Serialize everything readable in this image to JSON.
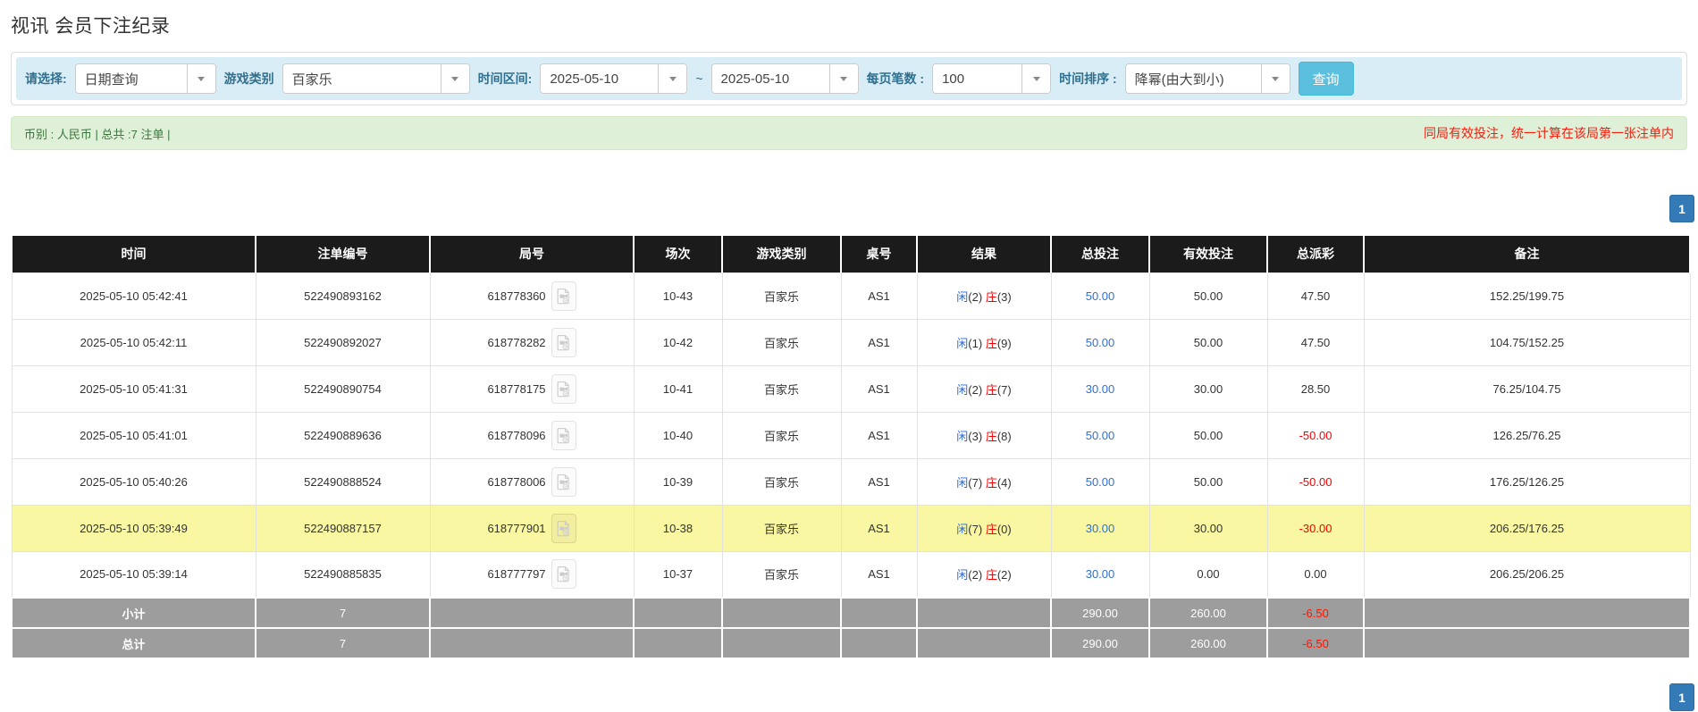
{
  "page": {
    "title": "视讯 会员下注纪录"
  },
  "colors": {
    "accent_blue": "#2e6fd8",
    "banker_red": "#f20000",
    "highlight_yellow": "#f9f7a1",
    "header_black": "#1b1b1b",
    "summary_gray": "#9d9d9d",
    "search_button_blue": "#5bc0de",
    "pagination_blue": "#337ab7",
    "filter_bar_blue": "#d9edf7",
    "info_bar_green": "#dff0d8"
  },
  "filter_bar": {
    "query_type": {
      "label": "请选择:",
      "value": "日期查询"
    },
    "game_category": {
      "label": "游戏类别",
      "value": "百家乐"
    },
    "time_range": {
      "label": "时间区间:",
      "from": "2025-05-10",
      "separator": "~",
      "to": "2025-05-10"
    },
    "page_size": {
      "label": "每页笔数 :",
      "value": "100"
    },
    "time_sort": {
      "label": "时间排序 :",
      "value": "降幂(由大到小)"
    },
    "search_button": "查询"
  },
  "info_bar": {
    "summary": "币别 : 人民币 | 总共 :7 注单 |",
    "notice": "同局有效投注，统一计算在该局第一张注单内"
  },
  "pagination": {
    "page": "1"
  },
  "table": {
    "columns": [
      "时间",
      "注单编号",
      "局号",
      "场次",
      "游戏类别",
      "桌号",
      "结果",
      "总投注",
      "有效投注",
      "总派彩",
      "备注"
    ],
    "rows": [
      {
        "time": "2025-05-10 05:42:41",
        "bet_no": "522490893162",
        "round_no": "618778360",
        "session": "10-43",
        "game": "百家乐",
        "table_no": "AS1",
        "result": {
          "player": "闲",
          "player_score": "(2)",
          "banker": "庄",
          "banker_score": "(3)"
        },
        "total_bet": "50.00",
        "valid_bet": "50.00",
        "payout": "47.50",
        "payout_negative": false,
        "highlight": false,
        "remark": "152.25/199.75"
      },
      {
        "time": "2025-05-10 05:42:11",
        "bet_no": "522490892027",
        "round_no": "618778282",
        "session": "10-42",
        "game": "百家乐",
        "table_no": "AS1",
        "result": {
          "player": "闲",
          "player_score": "(1)",
          "banker": "庄",
          "banker_score": "(9)"
        },
        "total_bet": "50.00",
        "valid_bet": "50.00",
        "payout": "47.50",
        "payout_negative": false,
        "highlight": false,
        "remark": "104.75/152.25"
      },
      {
        "time": "2025-05-10 05:41:31",
        "bet_no": "522490890754",
        "round_no": "618778175",
        "session": "10-41",
        "game": "百家乐",
        "table_no": "AS1",
        "result": {
          "player": "闲",
          "player_score": "(2)",
          "banker": "庄",
          "banker_score": "(7)"
        },
        "total_bet": "30.00",
        "valid_bet": "30.00",
        "payout": "28.50",
        "payout_negative": false,
        "highlight": false,
        "remark": "76.25/104.75"
      },
      {
        "time": "2025-05-10 05:41:01",
        "bet_no": "522490889636",
        "round_no": "618778096",
        "session": "10-40",
        "game": "百家乐",
        "table_no": "AS1",
        "result": {
          "player": "闲",
          "player_score": "(3)",
          "banker": "庄",
          "banker_score": "(8)"
        },
        "total_bet": "50.00",
        "valid_bet": "50.00",
        "payout": "-50.00",
        "payout_negative": true,
        "highlight": false,
        "remark": "126.25/76.25"
      },
      {
        "time": "2025-05-10 05:40:26",
        "bet_no": "522490888524",
        "round_no": "618778006",
        "session": "10-39",
        "game": "百家乐",
        "table_no": "AS1",
        "result": {
          "player": "闲",
          "player_score": "(7)",
          "banker": "庄",
          "banker_score": "(4)"
        },
        "total_bet": "50.00",
        "valid_bet": "50.00",
        "payout": "-50.00",
        "payout_negative": true,
        "highlight": false,
        "remark": "176.25/126.25"
      },
      {
        "time": "2025-05-10 05:39:49",
        "bet_no": "522490887157",
        "round_no": "618777901",
        "session": "10-38",
        "game": "百家乐",
        "table_no": "AS1",
        "result": {
          "player": "闲",
          "player_score": "(7)",
          "banker": "庄",
          "banker_score": "(0)"
        },
        "total_bet": "30.00",
        "valid_bet": "30.00",
        "payout": "-30.00",
        "payout_negative": true,
        "highlight": true,
        "remark": "206.25/176.25"
      },
      {
        "time": "2025-05-10 05:39:14",
        "bet_no": "522490885835",
        "round_no": "618777797",
        "session": "10-37",
        "game": "百家乐",
        "table_no": "AS1",
        "result": {
          "player": "闲",
          "player_score": "(2)",
          "banker": "庄",
          "banker_score": "(2)"
        },
        "total_bet": "30.00",
        "valid_bet": "0.00",
        "payout": "0.00",
        "payout_negative": false,
        "highlight": false,
        "remark": "206.25/206.25"
      }
    ],
    "summary": [
      {
        "label": "小计",
        "count": "7",
        "total_bet": "290.00",
        "valid_bet": "260.00",
        "payout": "-6.50",
        "payout_negative": true
      },
      {
        "label": "总计",
        "count": "7",
        "total_bet": "290.00",
        "valid_bet": "260.00",
        "payout": "-6.50",
        "payout_negative": true
      }
    ]
  }
}
